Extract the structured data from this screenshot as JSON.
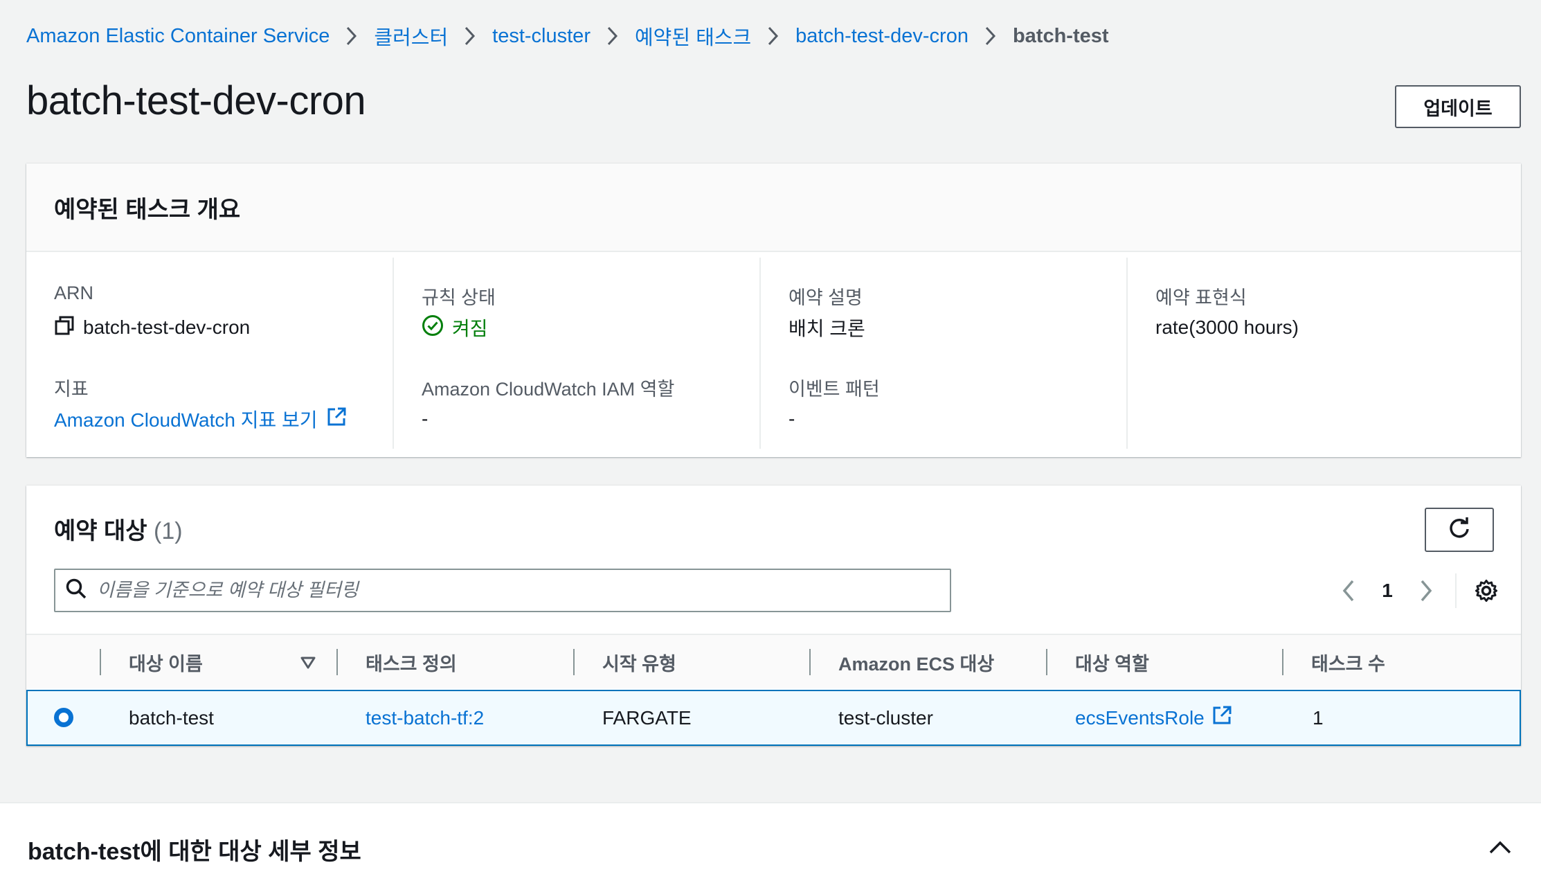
{
  "breadcrumb": {
    "items": [
      "Amazon Elastic Container Service",
      "클러스터",
      "test-cluster",
      "예약된 태스크",
      "batch-test-dev-cron",
      "batch-test"
    ]
  },
  "page": {
    "title": "batch-test-dev-cron",
    "update_button": "업데이트"
  },
  "overview": {
    "title": "예약된 태스크 개요",
    "arn_label": "ARN",
    "arn_value": "batch-test-dev-cron",
    "metrics_label": "지표",
    "metrics_link": "Amazon CloudWatch 지표 보기",
    "rule_state_label": "규칙 상태",
    "rule_state_value": "켜짐",
    "iam_role_label": "Amazon CloudWatch IAM 역할",
    "iam_role_value": "-",
    "schedule_desc_label": "예약 설명",
    "schedule_desc_value": "배치 크론",
    "event_pattern_label": "이벤트 패턴",
    "event_pattern_value": "-",
    "schedule_expr_label": "예약 표현식",
    "schedule_expr_value": "rate(3000 hours)"
  },
  "targets": {
    "title": "예약 대상",
    "count": "(1)",
    "search_placeholder": "이름을 기준으로 예약 대상 필터링",
    "page_number": "1",
    "columns": [
      "대상 이름",
      "태스크 정의",
      "시작 유형",
      "Amazon ECS 대상",
      "대상 역할",
      "태스크 수"
    ],
    "rows": [
      {
        "name": "batch-test",
        "task_definition": "test-batch-tf:2",
        "launch_type": "FARGATE",
        "ecs_target": "test-cluster",
        "role": "ecsEventsRole",
        "task_count": "1",
        "selected": true
      }
    ]
  },
  "details": {
    "title": "batch-test에 대한 대상 세부 정보"
  },
  "colors": {
    "link": "#0972d3",
    "success": "#037f0c",
    "selected_row_bg": "#f1faff",
    "selected_row_border": "#0073bb"
  }
}
